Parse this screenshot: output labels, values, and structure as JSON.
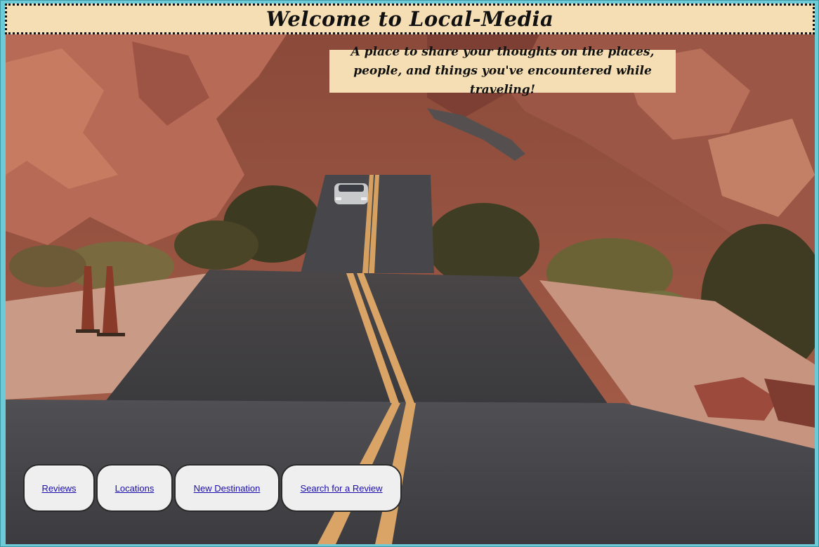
{
  "header": {
    "title": "Welcome to Local-Media"
  },
  "hero": {
    "tagline": "A place to share your thoughts on the places, people, and things you've encountered while traveling!",
    "image_description_icon": "desert-road-photo"
  },
  "nav": {
    "items": [
      {
        "label": "Reviews"
      },
      {
        "label": "Locations"
      },
      {
        "label": "New Destination"
      },
      {
        "label": "Search for a Review"
      }
    ]
  },
  "colors": {
    "page_background": "#6ccbd6",
    "banner_background": "#f5deb3",
    "button_background": "#efefef",
    "link": "#1a0dab"
  }
}
